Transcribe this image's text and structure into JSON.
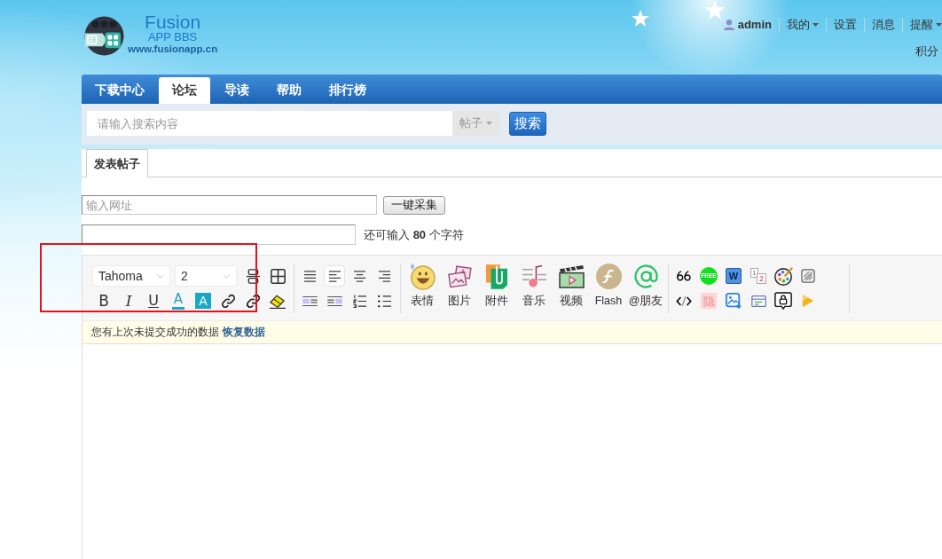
{
  "header": {
    "site_name": "Fusion",
    "site_subtitle": "APP BBS",
    "site_url": "www.fusionapp.cn",
    "user": {
      "name": "admin"
    },
    "user_menu": [
      {
        "label": "我的",
        "dropdown": true
      },
      {
        "label": "设置",
        "dropdown": false
      },
      {
        "label": "消息",
        "dropdown": false
      },
      {
        "label": "提醒",
        "dropdown": true
      }
    ],
    "credits": "积分"
  },
  "nav": {
    "tabs": [
      {
        "label": "下载中心",
        "selected": false
      },
      {
        "label": "论坛",
        "selected": true
      },
      {
        "label": "导读",
        "selected": false
      },
      {
        "label": "帮助",
        "selected": false
      },
      {
        "label": "排行榜",
        "selected": false
      }
    ]
  },
  "search": {
    "placeholder": "请输入搜索内容",
    "scope": "帖子",
    "button": "搜索"
  },
  "post_tabs": [
    {
      "label": "发表帖子",
      "selected": true
    }
  ],
  "collect": {
    "placeholder": "输入网址",
    "button": "一键采集"
  },
  "subject": {
    "remaining": "还可输入 **80** 个字符"
  },
  "editor": {
    "font": "Tahoma",
    "size": "2",
    "tools_row_1": [
      {
        "kind": "split"
      },
      {
        "kind": "table"
      }
    ],
    "format_tools": [
      {
        "kind": "bold",
        "glyph": "B"
      },
      {
        "kind": "italic",
        "glyph": "I"
      },
      {
        "kind": "underline",
        "glyph": "U"
      },
      {
        "kind": "font_color",
        "glyph": "A"
      },
      {
        "kind": "background_color",
        "glyph": "A"
      },
      {
        "kind": "link"
      },
      {
        "kind": "unlink"
      },
      {
        "kind": "eraser"
      }
    ],
    "align_tools": [
      {
        "kind": "justify",
        "selected": false
      },
      {
        "kind": "left",
        "selected": true
      },
      {
        "kind": "center",
        "selected": false
      },
      {
        "kind": "right",
        "selected": false
      }
    ],
    "block_tools": [
      {
        "kind": "float_left"
      },
      {
        "kind": "float_right"
      },
      {
        "kind": "ordered_list"
      },
      {
        "kind": "unordered_list"
      }
    ],
    "media_tools": [
      {
        "kind": "emoji",
        "label": "表情"
      },
      {
        "kind": "image",
        "label": "图片"
      },
      {
        "kind": "attachment",
        "label": "附件"
      },
      {
        "kind": "music",
        "label": "音乐"
      },
      {
        "kind": "video",
        "label": "视频"
      },
      {
        "kind": "flash",
        "label": "Flash"
      },
      {
        "kind": "mention",
        "label": "@朋友"
      }
    ],
    "extra_tools_row_1": [
      {
        "kind": "quote"
      },
      {
        "kind": "free",
        "glyph": "FREE"
      },
      {
        "kind": "word",
        "glyph": "W"
      },
      {
        "kind": "page_numbers",
        "glyphs": [
          "1",
          "2"
        ]
      },
      {
        "kind": "palette"
      },
      {
        "kind": "hatch"
      }
    ],
    "extra_tools_row_2": [
      {
        "kind": "code"
      },
      {
        "kind": "hide",
        "glyph": "隐"
      },
      {
        "kind": "image_download"
      },
      {
        "kind": "card"
      },
      {
        "kind": "lock"
      },
      {
        "kind": "play"
      }
    ]
  },
  "notice": {
    "text": "您有上次未提交成功的数据",
    "link": "恢复数据"
  }
}
